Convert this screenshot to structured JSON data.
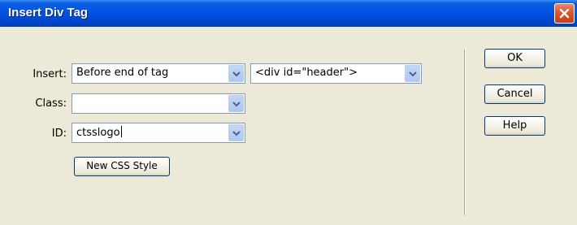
{
  "window": {
    "title": "Insert Div Tag"
  },
  "form": {
    "insert_label": "Insert:",
    "insert_value": "Before end of tag",
    "tag_value": "<div id=\"header\">",
    "class_label": "Class:",
    "class_value": "",
    "id_label": "ID:",
    "id_value": "ctsslogo",
    "new_css_style": "New CSS Style"
  },
  "buttons": {
    "ok": "OK",
    "cancel": "Cancel",
    "help": "Help"
  },
  "icons": {
    "close": "close-icon",
    "dropdown": "chevron-down-icon"
  },
  "colors": {
    "titlebar": "#0054e3",
    "close": "#d9532c",
    "dialog_bg": "#ece9d8"
  }
}
